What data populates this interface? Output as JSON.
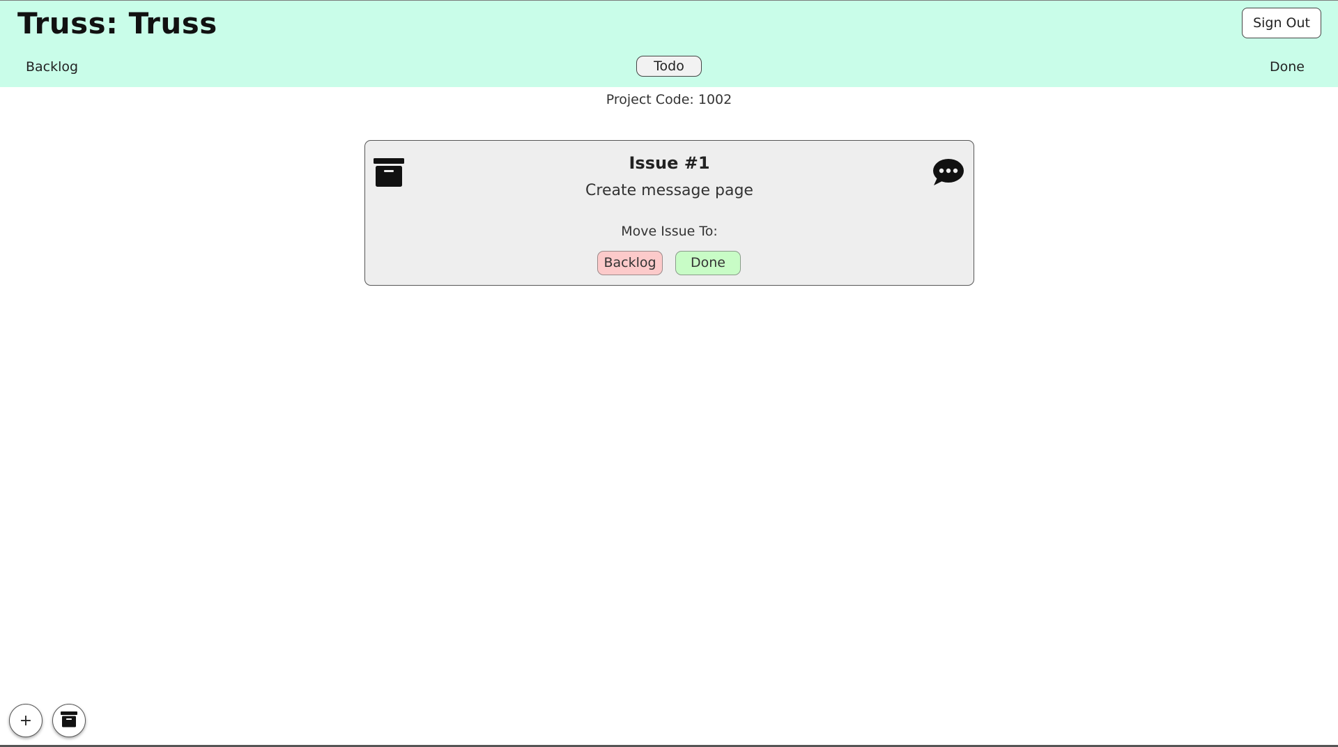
{
  "header": {
    "title": "Truss: Truss",
    "sign_out_label": "Sign Out",
    "background_color": "#c9fde9"
  },
  "nav": {
    "left_label": "Backlog",
    "center_label": "Todo",
    "right_label": "Done"
  },
  "project": {
    "code_text": "Project Code: 1002"
  },
  "issues": [
    {
      "title": "Issue #1",
      "description": "Create message page",
      "move_label": "Move Issue To:",
      "move_options": [
        {
          "label": "Backlog",
          "color": "#fccaca"
        },
        {
          "label": "Done",
          "color": "#c8fcc6"
        }
      ],
      "icons": [
        "archive-icon",
        "chat-dots-icon"
      ]
    }
  ],
  "floating_actions": {
    "add_label": "+",
    "archive_icon": "archive-icon"
  }
}
